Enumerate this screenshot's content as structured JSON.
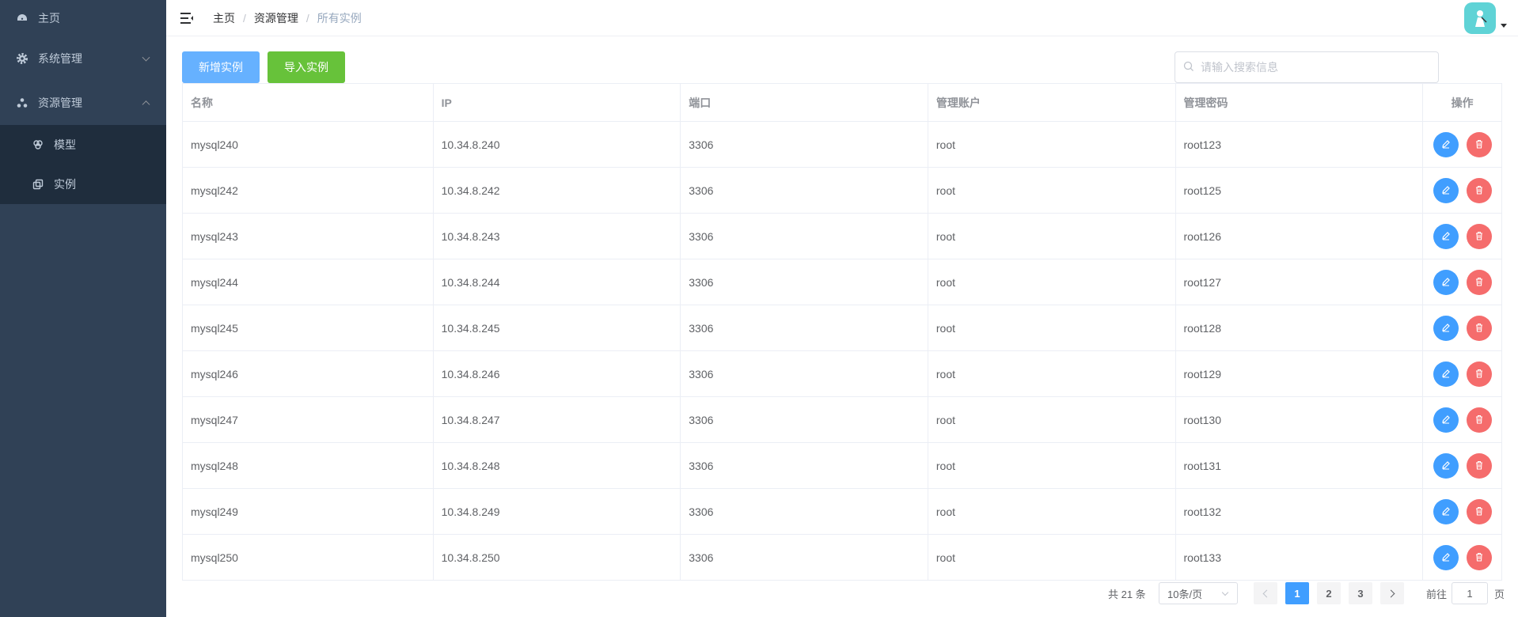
{
  "sidebar": {
    "items": [
      {
        "label": "主页",
        "icon": "dashboard-icon"
      },
      {
        "label": "系统管理",
        "icon": "gear-icon",
        "expanded": false
      },
      {
        "label": "资源管理",
        "icon": "cluster-icon",
        "expanded": true
      }
    ],
    "submenu": [
      {
        "label": "模型",
        "icon": "model-icon"
      },
      {
        "label": "实例",
        "icon": "copy-icon"
      }
    ]
  },
  "header": {
    "breadcrumb": [
      "主页",
      "资源管理",
      "所有实例"
    ],
    "separator": "/"
  },
  "toolbar": {
    "add_label": "新增实例",
    "import_label": "导入实例",
    "search_placeholder": "请输入搜索信息"
  },
  "table": {
    "columns": [
      "名称",
      "IP",
      "端口",
      "管理账户",
      "管理密码",
      "操作"
    ],
    "rows": [
      [
        "mysql240",
        "10.34.8.240",
        "3306",
        "root",
        "root123"
      ],
      [
        "mysql242",
        "10.34.8.242",
        "3306",
        "root",
        "root125"
      ],
      [
        "mysql243",
        "10.34.8.243",
        "3306",
        "root",
        "root126"
      ],
      [
        "mysql244",
        "10.34.8.244",
        "3306",
        "root",
        "root127"
      ],
      [
        "mysql245",
        "10.34.8.245",
        "3306",
        "root",
        "root128"
      ],
      [
        "mysql246",
        "10.34.8.246",
        "3306",
        "root",
        "root129"
      ],
      [
        "mysql247",
        "10.34.8.247",
        "3306",
        "root",
        "root130"
      ],
      [
        "mysql248",
        "10.34.8.248",
        "3306",
        "root",
        "root131"
      ],
      [
        "mysql249",
        "10.34.8.249",
        "3306",
        "root",
        "root132"
      ],
      [
        "mysql250",
        "10.34.8.250",
        "3306",
        "root",
        "root133"
      ]
    ]
  },
  "pagination": {
    "total_text": "共 21 条",
    "page_size": "10条/页",
    "pages": [
      "1",
      "2",
      "3"
    ],
    "current": "1",
    "goto_label": "前往",
    "goto_value": "1",
    "goto_unit": "页"
  },
  "colors": {
    "sidebar_bg": "#304156",
    "primary": "#409eff",
    "add_button": "#66b1ff",
    "import_button": "#67c23a",
    "danger": "#f56c6c"
  }
}
